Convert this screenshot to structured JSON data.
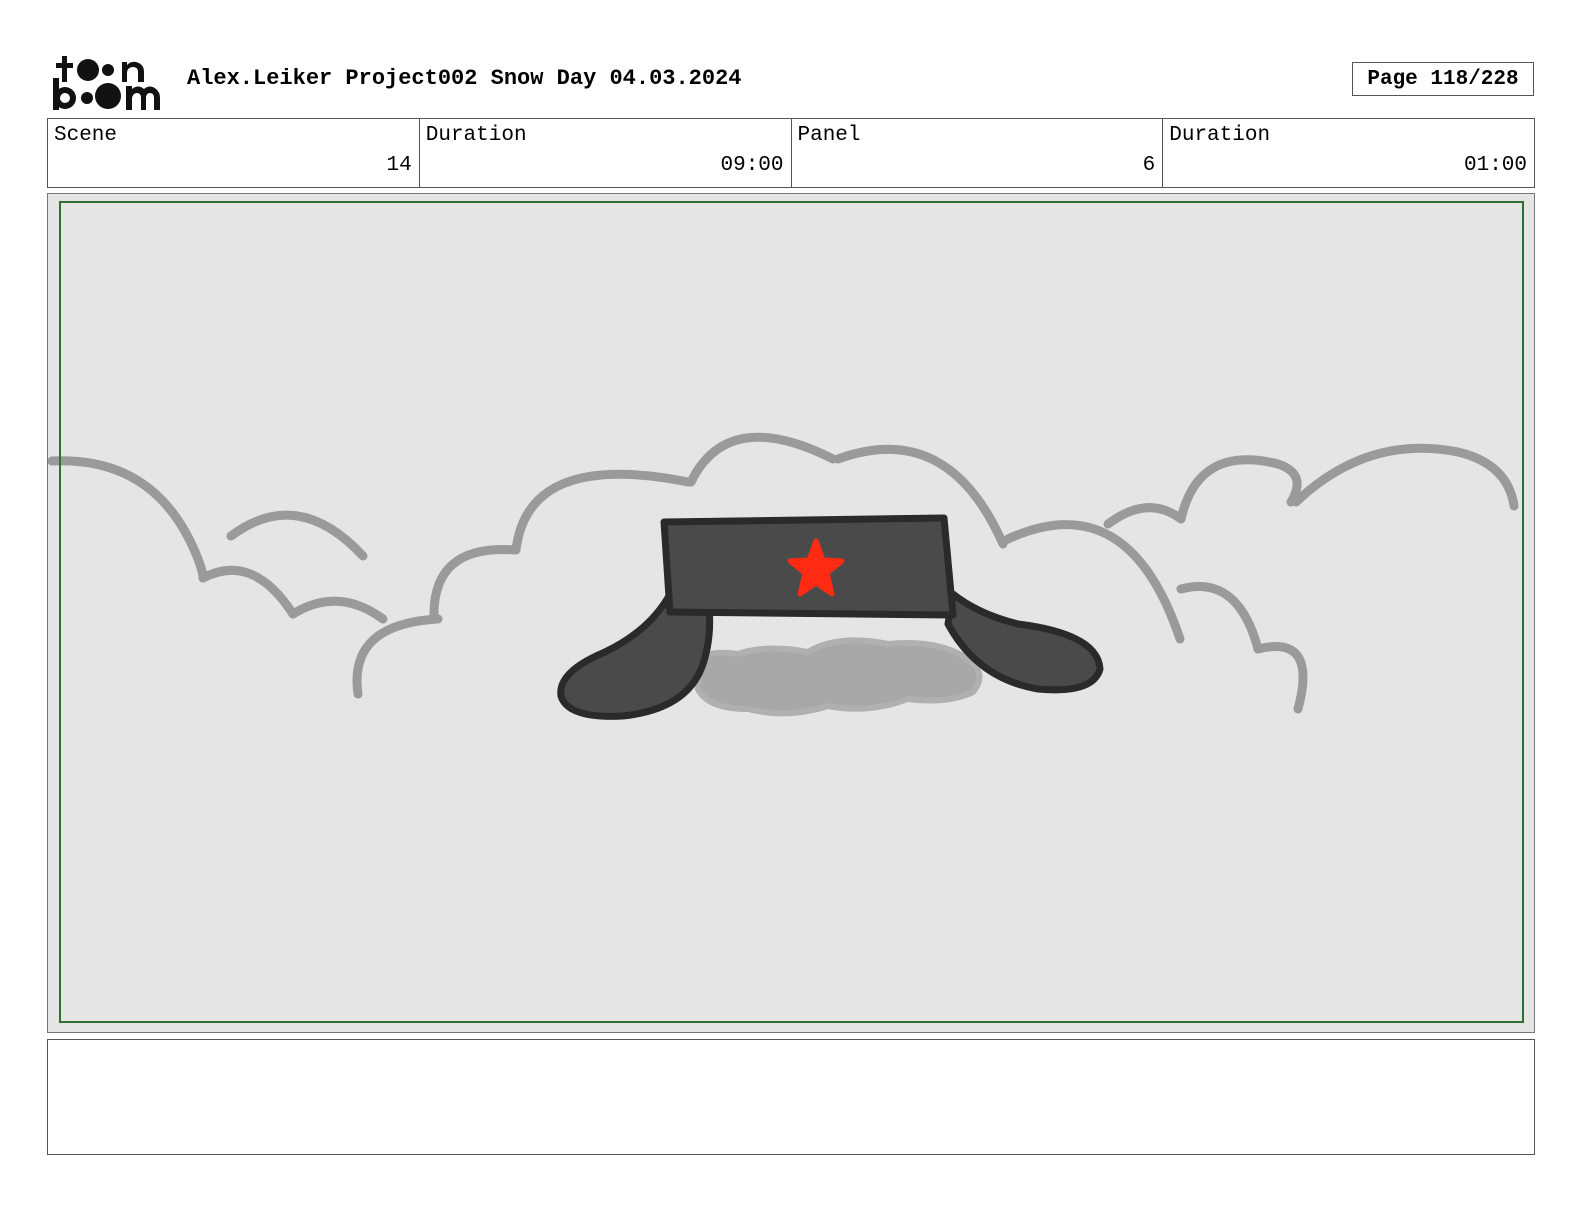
{
  "header": {
    "logo_alt": "toon boom",
    "title": "Alex.Leiker Project002 Snow Day 04.03.2024",
    "page": "Page 118/228"
  },
  "info": {
    "scene_label": "Scene",
    "scene_value": "14",
    "scene_duration_label": "Duration",
    "scene_duration_value": "09:00",
    "panel_label": "Panel",
    "panel_value": "6",
    "panel_duration_label": "Duration",
    "panel_duration_value": "01:00"
  },
  "panel": {
    "frame_border_color": "#2f6e2f",
    "background_color": "#e5e5e5",
    "illustration": "ushanka-hat-in-cloud-icon",
    "hat_color": "#4a4a4a",
    "star_color": "#ff2a12",
    "cloud_line_color": "#9a9a9a"
  },
  "notes": {
    "text": ""
  }
}
